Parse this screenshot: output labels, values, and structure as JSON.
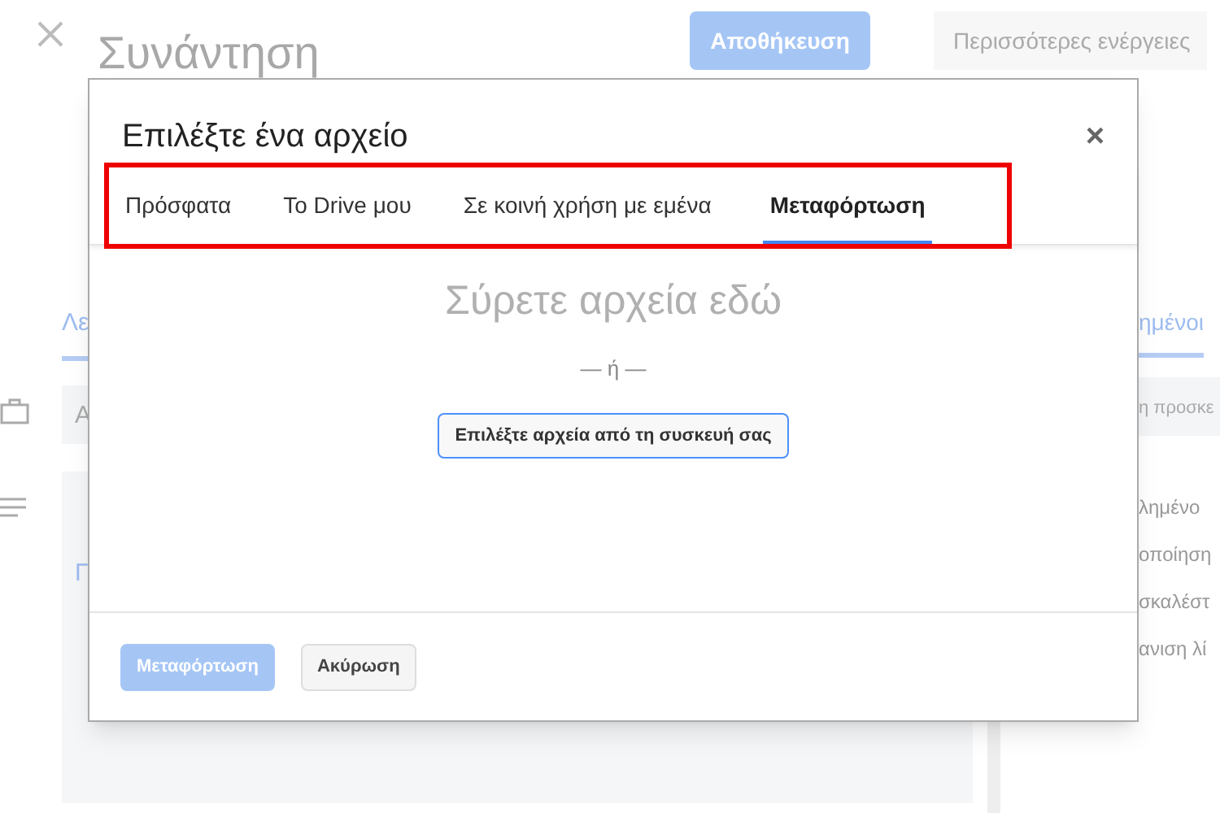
{
  "page": {
    "title": "Συνάντηση",
    "save_button": "Αποθήκευση",
    "more_button": "Περισσότερες ενέργειες",
    "left_tab": "Λε",
    "field_1": "Α",
    "field_2": "Γ",
    "right_tab": "ημένοι",
    "right_field": "η προσκε",
    "right_items": [
      "λημένο",
      "οποίηση",
      "σκαλέστ",
      "ανιση λί"
    ]
  },
  "dialog": {
    "title": "Επιλέξτε ένα αρχείο",
    "close": "×",
    "tabs": [
      {
        "label": "Πρόσφατα",
        "selected": false
      },
      {
        "label": "Το Drive μου",
        "selected": false
      },
      {
        "label": "Σε κοινή χρήση με εμένα",
        "selected": false
      },
      {
        "label": "Μεταφόρτωση",
        "selected": true
      }
    ],
    "drop_text": "Σύρετε αρχεία εδώ",
    "or_text": "— ή —",
    "choose_button": "Επιλέξτε αρχεία από τη συσκευή σας",
    "buttons": [
      {
        "label": "Μεταφόρτωση",
        "kind": "primary",
        "disabled": true
      },
      {
        "label": "Ακύρωση",
        "kind": "secondary",
        "disabled": false
      }
    ]
  }
}
